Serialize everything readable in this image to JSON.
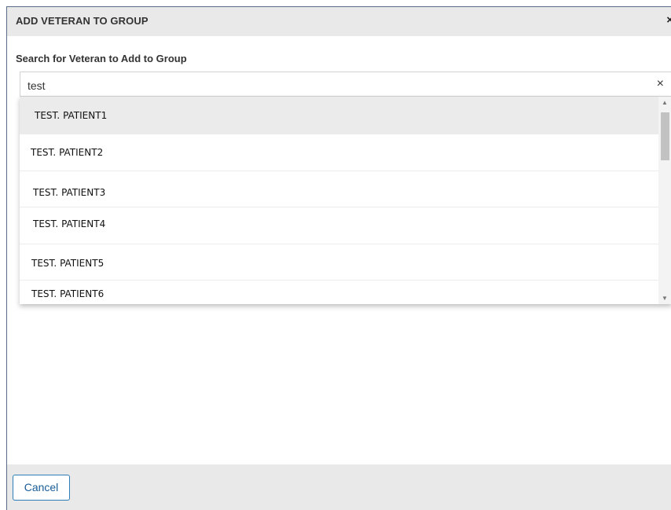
{
  "dialog": {
    "title": "ADD VETERAN TO GROUP",
    "close_glyph": "×",
    "close_icon": "close-icon"
  },
  "search": {
    "label": "Search for Veteran to Add to Group",
    "value": "test",
    "clear_glyph": "×",
    "clear_icon": "clear-icon"
  },
  "results": [
    "TEST. PATIENT1",
    "TEST. PATIENT2",
    "TEST. PATIENT3",
    "TEST. PATIENT4",
    "TEST. PATIENT5",
    "TEST. PATIENT6"
  ],
  "scrollbar": {
    "up_glyph": "▲",
    "down_glyph": "▼"
  },
  "footer": {
    "cancel_label": "Cancel"
  },
  "colors": {
    "header_bg": "#e9e9e9",
    "highlight_row": "#ebebeb",
    "cancel_border": "#2e7fb8",
    "cancel_text": "#1a5c97"
  }
}
